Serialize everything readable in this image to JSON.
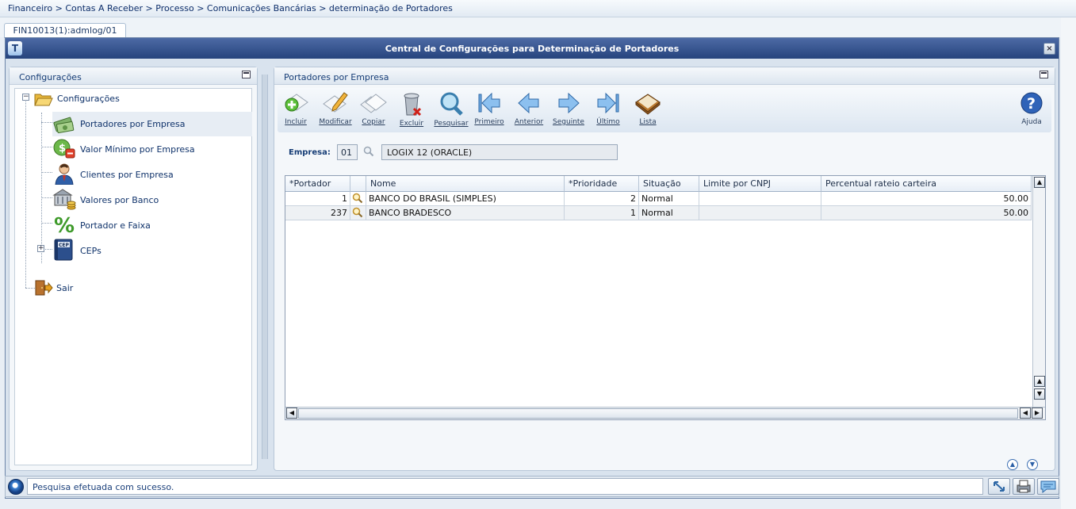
{
  "breadcrumb": "Financeiro > Contas A Receber > Processo > Comunicações Bancárias > determinação de Portadores",
  "tab": "FIN10013(1):admlog/01",
  "window": {
    "title": "Central de Configurações para Determinação de Portadores",
    "close_label": "×",
    "logo": "T"
  },
  "left_panel": {
    "title": "Configurações",
    "tree": {
      "root": "Configurações",
      "items": [
        {
          "label": "Portadores por Empresa",
          "icon": "bank-money-icon",
          "selected": true
        },
        {
          "label": "Valor Mínimo por Empresa",
          "icon": "dollar-coin-icon"
        },
        {
          "label": "Clientes por Empresa",
          "icon": "person-icon"
        },
        {
          "label": "Valores por Banco",
          "icon": "bank-coins-icon"
        },
        {
          "label": "Portador e Faixa",
          "icon": "percent-icon"
        },
        {
          "label": "CEPs",
          "icon": "cep-book-icon"
        }
      ],
      "exit": "Sair"
    }
  },
  "right_panel": {
    "title": "Portadores por Empresa",
    "toolbar": [
      {
        "label": "Incluir",
        "icon": "add-document-icon"
      },
      {
        "label": "Modificar",
        "icon": "edit-document-icon"
      },
      {
        "label": "Copiar",
        "icon": "copy-document-icon"
      },
      {
        "label": "Excluir",
        "icon": "trash-icon"
      },
      {
        "label": "Pesquisar",
        "icon": "magnifier-icon"
      },
      {
        "label": "Primeiro",
        "icon": "first-arrow-icon"
      },
      {
        "label": "Anterior",
        "icon": "previous-arrow-icon"
      },
      {
        "label": "Seguinte",
        "icon": "next-arrow-icon"
      },
      {
        "label": "Último",
        "icon": "last-arrow-icon"
      },
      {
        "label": "Lista",
        "icon": "book-icon"
      }
    ],
    "help_label": "Ajuda",
    "empresa": {
      "label": "Empresa:",
      "code": "01",
      "name": "LOGIX 12 (ORACLE)"
    },
    "grid": {
      "columns": [
        "*Portador",
        "",
        "Nome",
        "*Prioridade",
        "Situação",
        "Limite por CNPJ",
        "Percentual rateio carteira"
      ],
      "rows": [
        {
          "portador": "1",
          "nome": "BANCO DO BRASIL (SIMPLES)",
          "prioridade": "2",
          "situacao": "Normal",
          "limite": "",
          "percentual": "50.00"
        },
        {
          "portador": "237",
          "nome": "BANCO BRADESCO",
          "prioridade": "1",
          "situacao": "Normal",
          "limite": "",
          "percentual": "50.00"
        }
      ]
    }
  },
  "status": {
    "message": "Pesquisa efetuada com sucesso."
  },
  "colors": {
    "title_bar": "#26447d",
    "panel_title": "#163d76",
    "link": "#0e2f6b"
  }
}
